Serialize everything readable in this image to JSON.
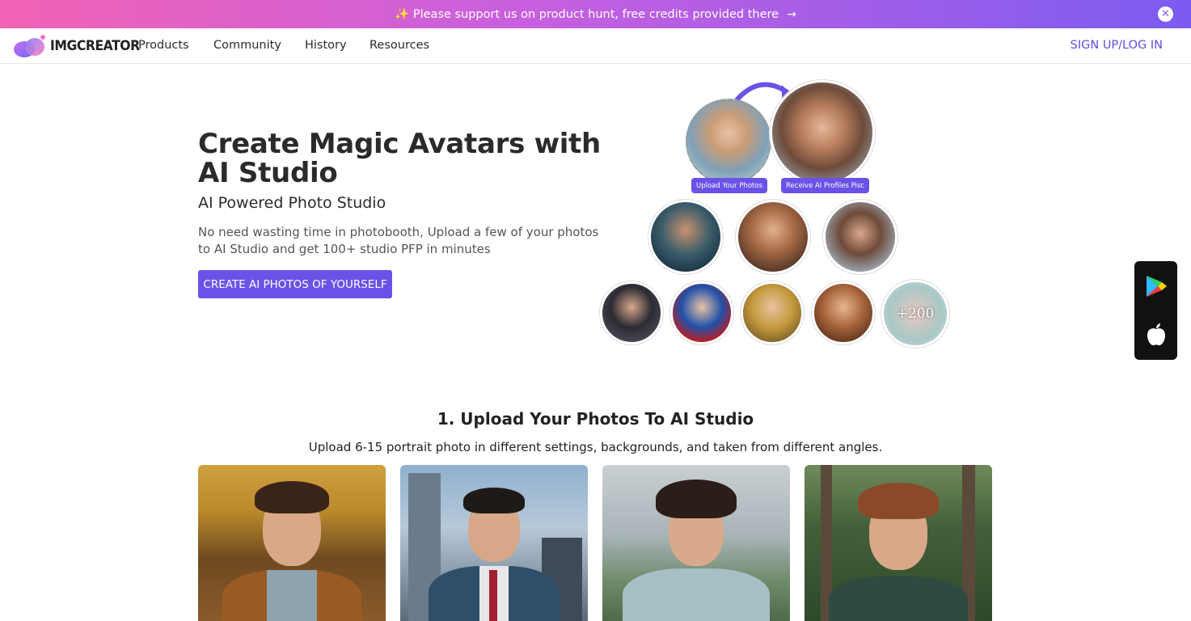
{
  "banner": {
    "text": "✨ Please support us on product hunt, free credits provided there",
    "arrow_icon": "→",
    "close_icon": "✕"
  },
  "nav": {
    "logo_text": "IMGCREATOR",
    "items": [
      "Products",
      "Community",
      "History",
      "Resources"
    ],
    "signup": "SIGN UP/LOG IN"
  },
  "hero": {
    "title": "Create Magic Avatars with AI Studio",
    "subtitle": "AI Powered Photo Studio",
    "description": "No need wasting time in photobooth, Upload a few of your photos to AI Studio and get 100+ studio PFP in minutes",
    "cta": "CREATE AI PHOTOS OF YOURSELF",
    "tag_upload": "Upload Your Photos",
    "tag_receive": "Receive AI Profiles Pisc",
    "more_count": "+200"
  },
  "section": {
    "title": "1. Upload Your Photos To AI Studio",
    "description": "Upload 6-15 portrait photo in different settings, backgrounds, and taken from different angles."
  },
  "colors": {
    "accent": "#6a52e8",
    "banner_start": "#f263b5",
    "banner_end": "#7b5cf0"
  },
  "icons": {
    "play_store": "google-play-icon",
    "app_store": "apple-icon"
  }
}
